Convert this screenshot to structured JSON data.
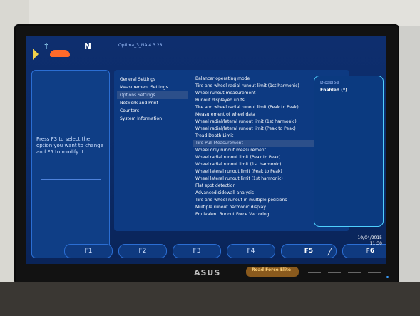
{
  "app": {
    "title": "Optima_3_NA 4.3.28i"
  },
  "left_panel": {
    "help_text": "Press F3 to select the option you want to change and F5 to modify it"
  },
  "settings": {
    "categories": [
      {
        "label": "General Settings",
        "selected": false
      },
      {
        "label": "Measurement Settings",
        "selected": false
      },
      {
        "label": "Options Settings",
        "selected": true
      },
      {
        "label": "Network and Print",
        "selected": false
      },
      {
        "label": "Counters",
        "selected": false
      },
      {
        "label": "System Information",
        "selected": false
      }
    ],
    "options": [
      {
        "label": "Balancer operating mode",
        "selected": false
      },
      {
        "label": "Tire and wheel radial runout limit (1st harmonic)",
        "selected": false
      },
      {
        "label": "Wheel runout measurement",
        "selected": false
      },
      {
        "label": "Runout displayed units",
        "selected": false
      },
      {
        "label": "Tire and wheel radial runout limit (Peak to Peak)",
        "selected": false
      },
      {
        "label": "Measurement of wheel data",
        "selected": false
      },
      {
        "label": "Wheel radial/lateral runout limit (1st harmonic)",
        "selected": false
      },
      {
        "label": "Wheel radial/lateral runout limit (Peak to Peak)",
        "selected": false
      },
      {
        "label": "Tread Depth Limit",
        "selected": false
      },
      {
        "label": "Tire Pull Measurement",
        "selected": true
      },
      {
        "label": "Wheel only runout measurement",
        "selected": false
      },
      {
        "label": "Wheel radial runout limit (Peak to Peak)",
        "selected": false
      },
      {
        "label": "Wheel radial runout limit (1st harmonic)",
        "selected": false
      },
      {
        "label": "Wheel lateral runout limit (Peak to Peak)",
        "selected": false
      },
      {
        "label": "Wheel lateral runout limit (1st harmonic)",
        "selected": false
      },
      {
        "label": "Flat spot detection",
        "selected": false
      },
      {
        "label": "Advanced sidewall analysis",
        "selected": false
      },
      {
        "label": "Tire and wheel runout in multiple positions",
        "selected": false
      },
      {
        "label": "Multiple runout harmonic display",
        "selected": false
      },
      {
        "label": "Equivalent Runout Force Vectoring",
        "selected": false
      }
    ],
    "values": {
      "disabled": "Disabled",
      "enabled": "Enabled (*)"
    }
  },
  "function_keys": [
    {
      "label": "F1"
    },
    {
      "label": "F2"
    },
    {
      "label": "F3"
    },
    {
      "label": "F4"
    },
    {
      "label": "F5"
    },
    {
      "label": "F6"
    }
  ],
  "status": {
    "date": "10/04/2015",
    "time": "11:30"
  },
  "bezel": {
    "brand": "ASUS",
    "sticker": "Road Force Elite"
  }
}
